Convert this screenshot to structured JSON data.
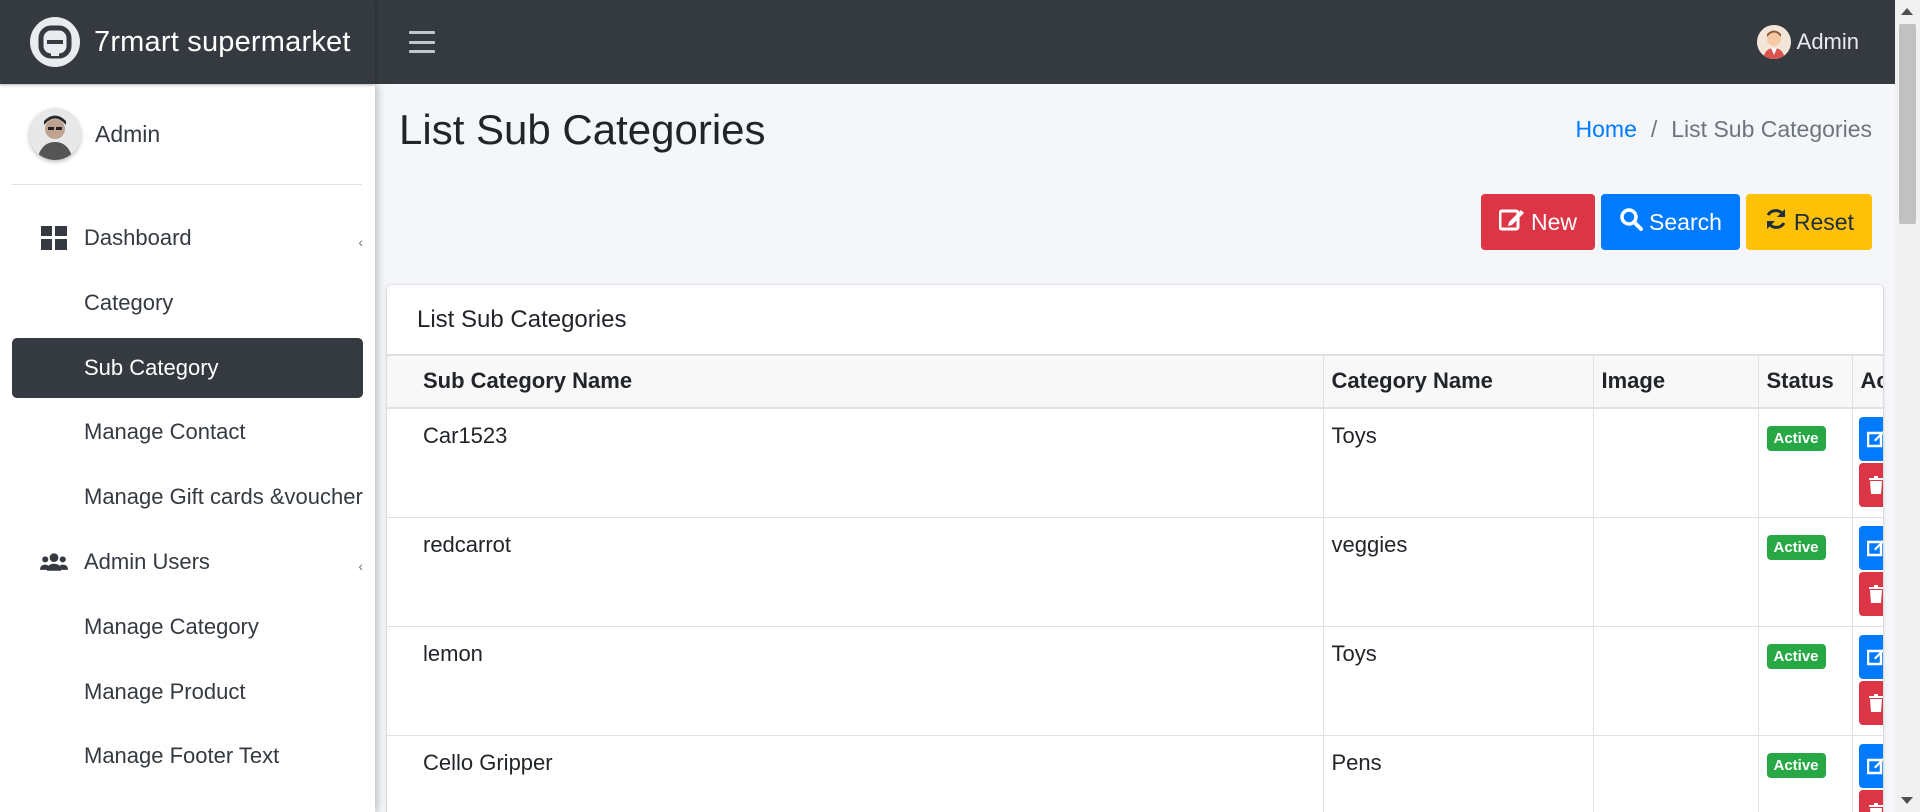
{
  "app": {
    "brand": "7rmart supermarket"
  },
  "header": {
    "user_label": "Admin"
  },
  "sidebar": {
    "user_name": "Admin",
    "items": [
      {
        "label": "Dashboard",
        "icon": "dashboard-icon",
        "has_arrow": true
      },
      {
        "label": "Category"
      },
      {
        "label": "Sub Category",
        "active": true
      },
      {
        "label": "Manage Contact"
      },
      {
        "label": "Manage Gift cards &voucher"
      },
      {
        "label": "Admin Users",
        "icon": "users-icon",
        "has_arrow": true
      },
      {
        "label": "Manage Category"
      },
      {
        "label": "Manage Product"
      },
      {
        "label": "Manage Footer Text"
      }
    ],
    "arrow_glyph": "‹"
  },
  "page": {
    "title": "List Sub Categories",
    "breadcrumb_home": "Home",
    "breadcrumb_sep": "/",
    "breadcrumb_current": "List Sub Categories"
  },
  "actions": {
    "new_label": "New",
    "search_label": "Search",
    "reset_label": "Reset"
  },
  "card": {
    "title": "List Sub Categories"
  },
  "table": {
    "headers": {
      "name": "Sub Category Name",
      "category": "Category Name",
      "image": "Image",
      "status": "Status",
      "action": "Ac"
    },
    "rows": [
      {
        "name": "Car1523",
        "category": "Toys",
        "image": "",
        "status": "Active"
      },
      {
        "name": "redcarrot",
        "category": "veggies",
        "image": "",
        "status": "Active"
      },
      {
        "name": "lemon",
        "category": "Toys",
        "image": "",
        "status": "Active"
      },
      {
        "name": "Cello Gripper",
        "category": "Pens",
        "image": "",
        "status": "Active"
      }
    ]
  },
  "colors": {
    "dark": "#343a40",
    "primary": "#007bff",
    "danger": "#dc3545",
    "warning": "#ffc107",
    "success": "#28a745"
  }
}
